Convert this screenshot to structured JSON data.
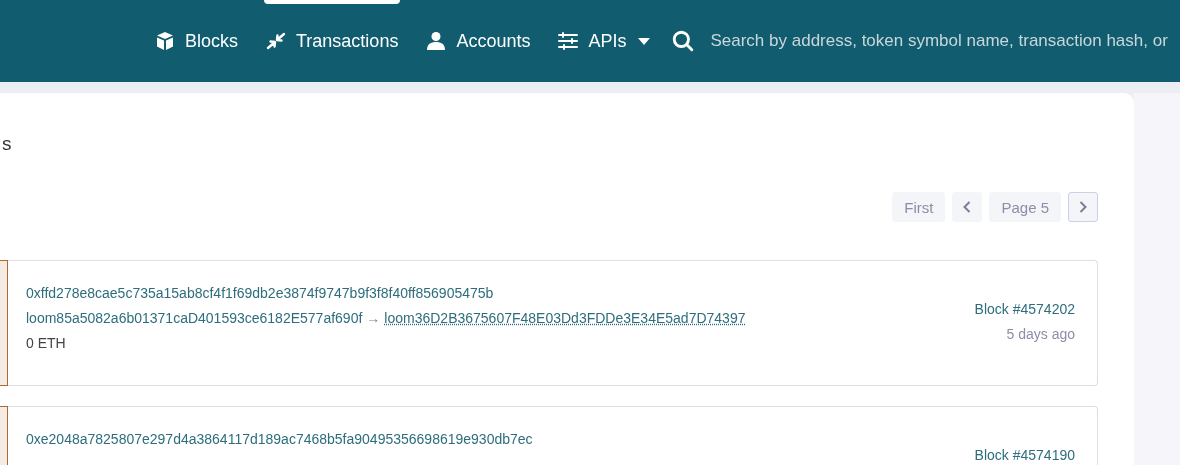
{
  "nav": {
    "items": [
      {
        "label": "Blocks",
        "kind": "cube",
        "selected": false
      },
      {
        "label": "Transactions",
        "kind": "arrows",
        "selected": true
      },
      {
        "label": "Accounts",
        "kind": "person",
        "selected": false
      },
      {
        "label": "APIs",
        "kind": "sliders",
        "selected": false,
        "dropdown": true
      }
    ],
    "search": {
      "placeholder": "Search by address, token symbol name, transaction hash, or"
    }
  },
  "page": {
    "title": "s",
    "pagination": [
      {
        "label": "First",
        "kind": "text",
        "disabled": true
      },
      {
        "kind": "prev",
        "disabled": true
      },
      {
        "label": "Page 5",
        "kind": "text",
        "disabled": true
      },
      {
        "kind": "next",
        "disabled": false
      }
    ],
    "transactions": [
      {
        "hash": "0xffd278e8cae5c735a15ab8cf4f1f69db2e3874f9747b9f3f8f40ff856905475b",
        "from": "loom85a5082a6b01371caD401593ce6182E577af690f",
        "arrow": "→",
        "to": "loom36D2B3675607F48E03Dd3FDDe3E34E5ad7D74397",
        "value": "0 ETH",
        "block": "Block #4574202",
        "age": "5 days ago"
      },
      {
        "hash": "0xe2048a7825807e297d4a3864117d189ac7468b5fa90495356698619e930db7ec",
        "block": "Block #4574190"
      }
    ]
  }
}
